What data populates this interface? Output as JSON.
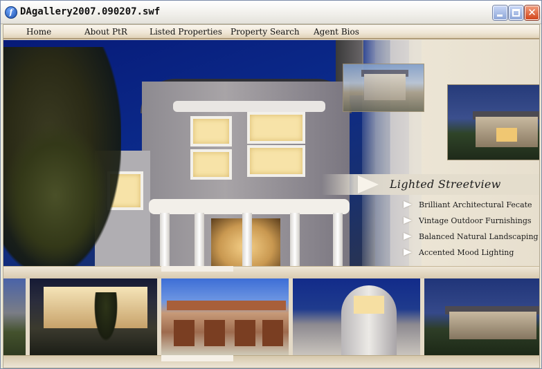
{
  "window": {
    "title": "DAgallery2007.090207.swf",
    "close_glyph": "✕",
    "app_icon_glyph": "f"
  },
  "nav": {
    "items": [
      "Home",
      "About PtR",
      "Listed Properties",
      "Property Search",
      "Agent Bios"
    ]
  },
  "feature": {
    "caption": "Lighted Streetview",
    "bullets": [
      "Brilliant Architectural Fecate",
      "Vintage Outdoor Furnishings",
      "Balanced Natural Landscaping",
      "Accented Mood Lighting"
    ]
  },
  "icons": {
    "app": "flash-player-icon",
    "minimize": "minimize-icon",
    "maximize": "maximize-icon",
    "close": "close-icon",
    "bullet": "arrow-bullet-icon"
  },
  "colors": {
    "panel_beige": "#ece5d5",
    "nav_border": "#b09c79",
    "night_sky": "#0b2a8a",
    "window_glow": "#f7e3a8"
  }
}
